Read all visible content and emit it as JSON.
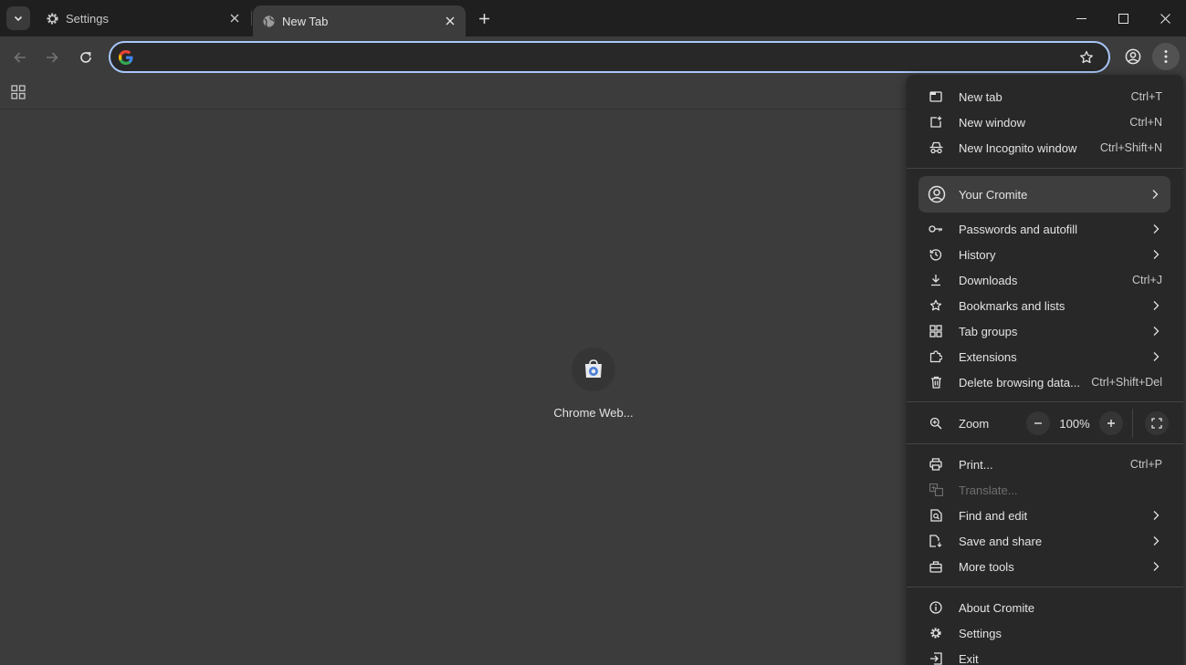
{
  "tabs": [
    {
      "title": "Settings",
      "icon": "gear-icon",
      "active": false
    },
    {
      "title": "New Tab",
      "icon": "globe-icon",
      "active": true
    }
  ],
  "omnibox": {
    "value": "",
    "placeholder": ""
  },
  "shortcut": {
    "label": "Chrome Web..."
  },
  "menu": {
    "group1": [
      {
        "label": "New tab",
        "shortcut": "Ctrl+T",
        "icon": "new-tab-icon"
      },
      {
        "label": "New window",
        "shortcut": "Ctrl+N",
        "icon": "new-window-icon"
      },
      {
        "label": "New Incognito window",
        "shortcut": "Ctrl+Shift+N",
        "icon": "incognito-icon"
      }
    ],
    "profile": {
      "label": "Your Cromite",
      "icon": "account-circle-icon"
    },
    "group2": [
      {
        "label": "Passwords and autofill",
        "shortcut": "",
        "icon": "key-icon",
        "submenu": true
      },
      {
        "label": "History",
        "shortcut": "",
        "icon": "history-icon",
        "submenu": true
      },
      {
        "label": "Downloads",
        "shortcut": "Ctrl+J",
        "icon": "download-icon",
        "submenu": false
      },
      {
        "label": "Bookmarks and lists",
        "shortcut": "",
        "icon": "star-icon",
        "submenu": true
      },
      {
        "label": "Tab groups",
        "shortcut": "",
        "icon": "tab-groups-icon",
        "submenu": true
      },
      {
        "label": "Extensions",
        "shortcut": "",
        "icon": "puzzle-icon",
        "submenu": true
      },
      {
        "label": "Delete browsing data...",
        "shortcut": "Ctrl+Shift+Del",
        "icon": "trash-icon",
        "submenu": false
      }
    ],
    "zoom": {
      "label": "Zoom",
      "value": "100%"
    },
    "group3": [
      {
        "label": "Print...",
        "shortcut": "Ctrl+P",
        "icon": "printer-icon",
        "submenu": false,
        "disabled": false
      },
      {
        "label": "Translate...",
        "shortcut": "",
        "icon": "translate-icon",
        "submenu": false,
        "disabled": true
      },
      {
        "label": "Find and edit",
        "shortcut": "",
        "icon": "find-page-icon",
        "submenu": true,
        "disabled": false
      },
      {
        "label": "Save and share",
        "shortcut": "",
        "icon": "save-share-icon",
        "submenu": true,
        "disabled": false
      },
      {
        "label": "More tools",
        "shortcut": "",
        "icon": "toolbox-icon",
        "submenu": true,
        "disabled": false
      }
    ],
    "group4": [
      {
        "label": "About Cromite",
        "icon": "info-icon"
      },
      {
        "label": "Settings",
        "icon": "gear-icon"
      },
      {
        "label": "Exit",
        "icon": "exit-icon"
      }
    ]
  },
  "colors": {
    "accent": "#a8c7fa",
    "background": "#3c3c3c",
    "menu_bg": "#282828",
    "tabstrip_bg": "#1f1f1f"
  }
}
